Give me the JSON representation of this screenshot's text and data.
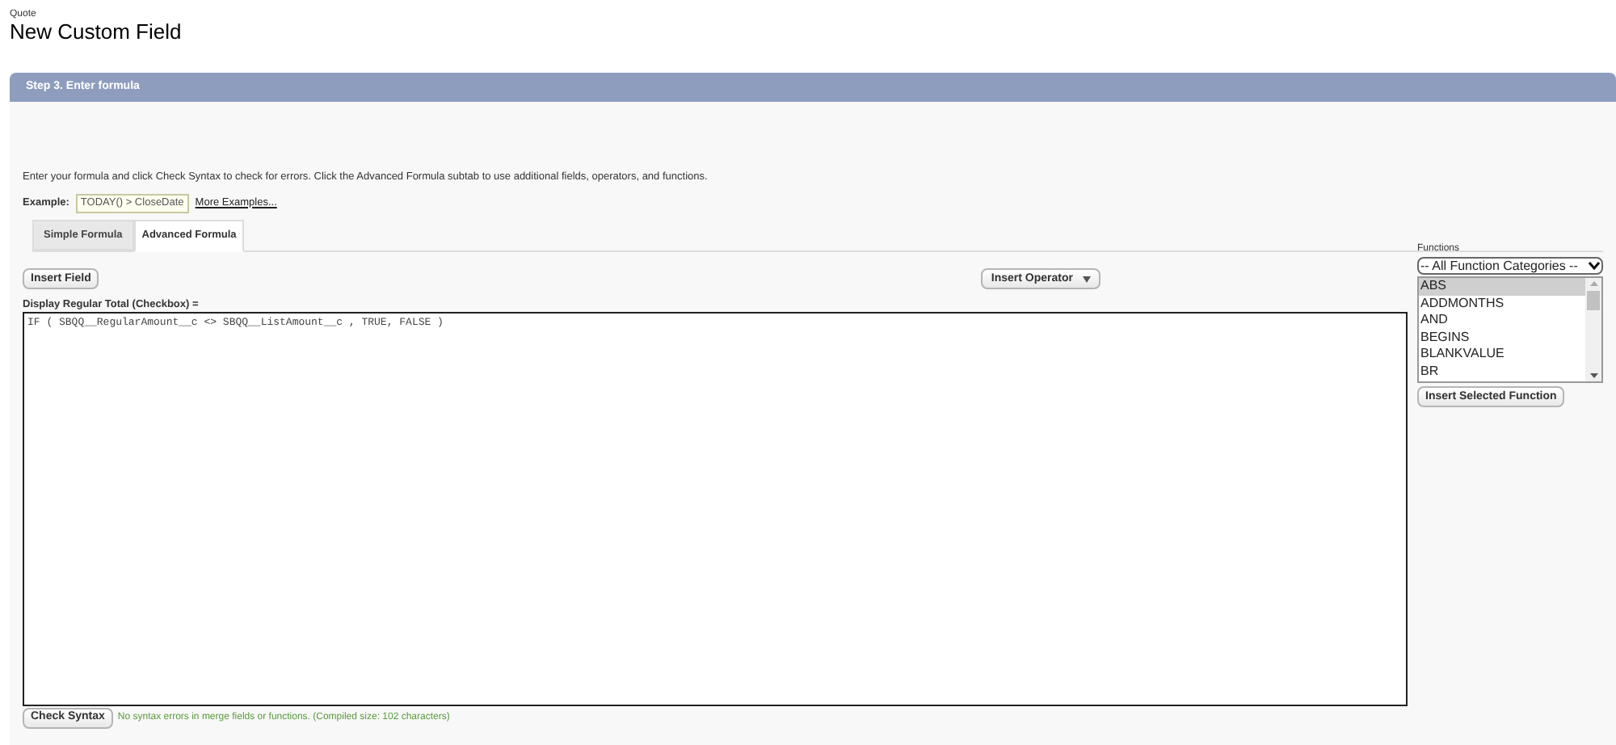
{
  "header": {
    "object": "Quote",
    "title": "New Custom Field"
  },
  "step": {
    "title": "Step 3. Enter formula"
  },
  "instructions": "Enter your formula and click Check Syntax to check for errors. Click the Advanced Formula subtab to use additional fields, operators, and functions.",
  "example": {
    "label": "Example:",
    "value": "TODAY() > CloseDate",
    "link": "More Examples..."
  },
  "tabs": [
    {
      "label": "Simple Formula",
      "selected": false
    },
    {
      "label": "Advanced Formula",
      "selected": true
    }
  ],
  "editor": {
    "insert_field": "Insert Field",
    "insert_operator": "Insert Operator",
    "field_label": "Display Regular Total (Checkbox) =",
    "formula": "IF ( SBQQ__RegularAmount__c <> SBQQ__ListAmount__c , TRUE, FALSE )"
  },
  "functions": {
    "label": "Functions",
    "category": "-- All Function Categories --",
    "items": [
      {
        "label": "ABS",
        "selected": true
      },
      {
        "label": "ADDMONTHS",
        "selected": false
      },
      {
        "label": "AND",
        "selected": false
      },
      {
        "label": "BEGINS",
        "selected": false
      },
      {
        "label": "BLANKVALUE",
        "selected": false
      },
      {
        "label": "BR",
        "selected": false
      }
    ],
    "insert": "Insert Selected Function"
  },
  "check": {
    "button": "Check Syntax",
    "message": "No syntax errors in merge fields or functions. (Compiled size: 102 characters)"
  }
}
